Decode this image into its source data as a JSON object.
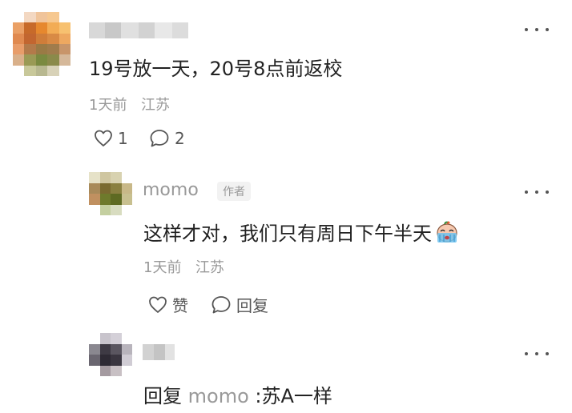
{
  "comment": {
    "text": "19号放一天，20号8点前返校",
    "time": "1天前",
    "location": "江苏",
    "like_count": "1",
    "reply_count": "2"
  },
  "reply1": {
    "username": "momo",
    "author_tag": "作者",
    "text": "这样才对，我们只有周日下午半天",
    "time": "1天前",
    "location": "江苏",
    "like_label": "赞",
    "reply_label": "回复"
  },
  "reply2": {
    "prefix": "回复",
    "mention": "momo",
    "separator": ":",
    "text": "苏A一样"
  },
  "icons": {
    "more": "more-icon",
    "like": "heart-icon",
    "comment": "comment-bubble-icon",
    "emoji": "crying-emoji-icon"
  }
}
